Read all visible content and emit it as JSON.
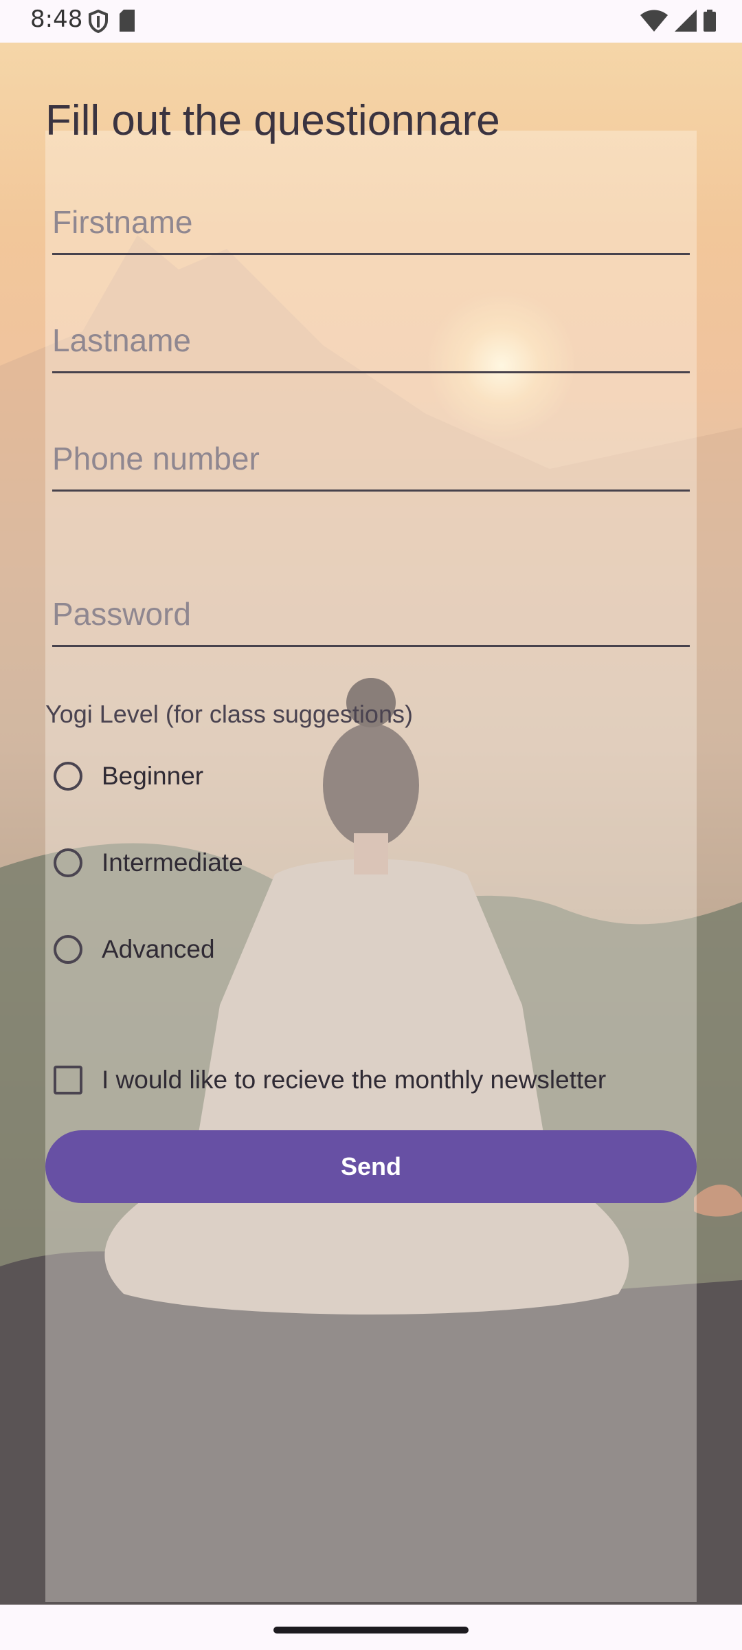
{
  "status_bar": {
    "time": "8:48",
    "left_icons": [
      "shield-icon",
      "sim-card-icon"
    ],
    "right_icons": [
      "wifi-icon",
      "signal-icon",
      "battery-icon"
    ]
  },
  "form": {
    "title": "Fill out the questionnare",
    "fields": [
      {
        "name": "firstname",
        "placeholder": "Firstname",
        "value": ""
      },
      {
        "name": "lastname",
        "placeholder": "Lastname",
        "value": ""
      },
      {
        "name": "phone",
        "placeholder": "Phone number",
        "value": ""
      },
      {
        "name": "password",
        "placeholder": "Password",
        "value": ""
      }
    ],
    "level_label": "Yogi Level (for class suggestions)",
    "levels": [
      "Beginner",
      "Intermediate",
      "Advanced"
    ],
    "newsletter_label": "I would like to recieve the monthly newsletter",
    "send_label": "Send"
  },
  "colors": {
    "accent": "#6750a4",
    "text": "#3a3340"
  }
}
